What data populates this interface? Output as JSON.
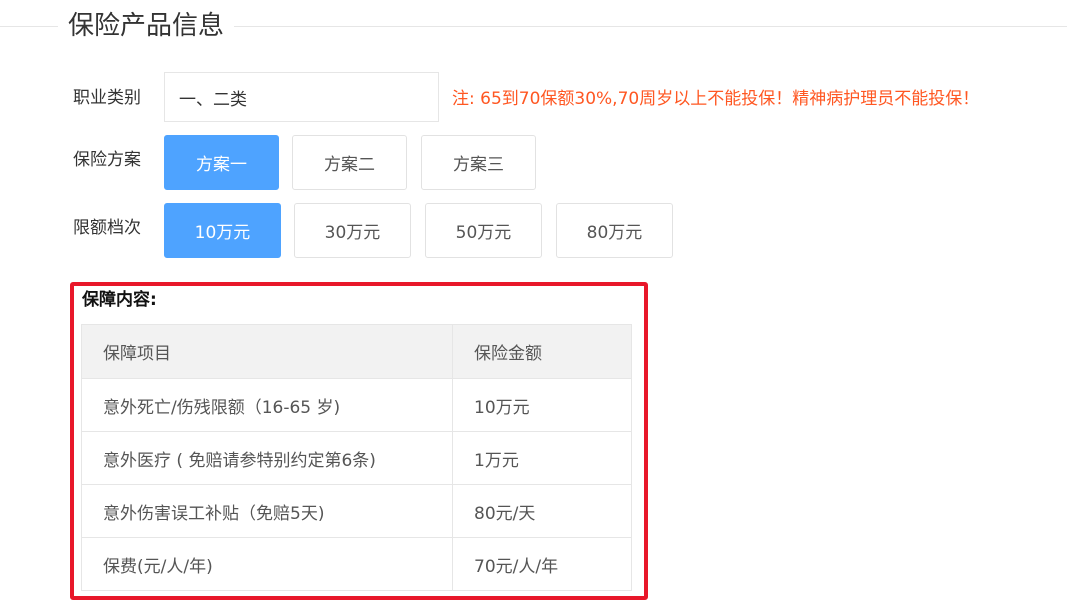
{
  "section": {
    "title": "保险产品信息"
  },
  "occupation": {
    "label": "职业类别",
    "value": "一、二类",
    "note": "注: 65到70保额30%,70周岁以上不能投保！精神病护理员不能投保！"
  },
  "plan": {
    "label": "保险方案",
    "options": [
      "方案一",
      "方案二",
      "方案三"
    ],
    "selected": "方案一"
  },
  "limit": {
    "label": "限额档次",
    "options": [
      "10万元",
      "30万元",
      "50万元",
      "80万元"
    ],
    "selected": "10万元"
  },
  "coverage": {
    "title": "保障内容:",
    "headers": [
      "保障项目",
      "保险金额"
    ],
    "rows": [
      [
        "意外死亡/伤残限额（16-65 岁)",
        "10万元"
      ],
      [
        "意外医疗 ( 免赔请参特别约定第6条)",
        "1万元"
      ],
      [
        "意外伤害误工补贴（免赔5天)",
        "80元/天"
      ],
      [
        "保费(元/人/年)",
        "70元/人/年"
      ]
    ]
  },
  "colors": {
    "accent": "#4ea3ff",
    "note": "#ff5722",
    "highlight_border": "#e8172a"
  }
}
